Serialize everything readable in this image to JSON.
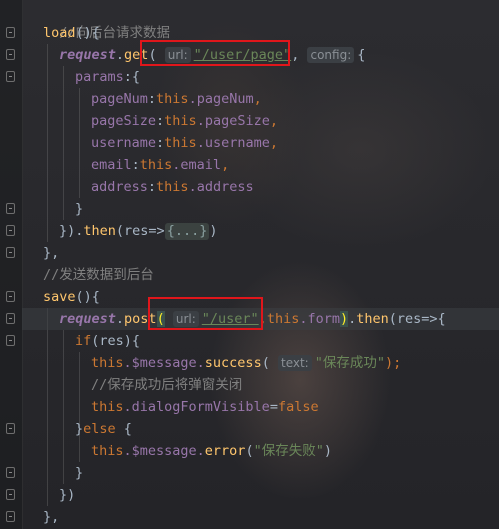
{
  "editor": {
    "lines": {
      "l1": "//向后台请求数据",
      "l2_name": "load",
      "l2_rest": "(){",
      "l3_obj": "request",
      "l3_dot": ".",
      "l3_method": "get",
      "l3_paren": "(",
      "l3_hint_url": "url:",
      "l3_url": "\"/user/page\"",
      "l3_comma": ",",
      "l3_hint_config": "config:",
      "l3_brace": "{",
      "l4_key": "params",
      "l4_rest": ":{",
      "l5_key": "pageNum",
      "l5_this": "this",
      "l5_prop": ".pageNum",
      "l5_end": ",",
      "l6_key": "pageSize",
      "l6_this": "this",
      "l6_prop": ".pageSize",
      "l6_end": ",",
      "l7_key": "username",
      "l7_this": "this",
      "l7_prop": ".username",
      "l7_end": ",",
      "l8_key": "email",
      "l8_this": "this",
      "l8_prop": ".email",
      "l8_end": ",",
      "l9_key": "address",
      "l9_this": "this",
      "l9_prop": ".address",
      "l10": "}",
      "l11_a": "}).",
      "l11_then": "then",
      "l11_b": "(res=>",
      "l11_folded": "{...}",
      "l11_c": ")",
      "l12": "},",
      "l13": "//发送数据到后台",
      "l14_name": "save",
      "l14_rest": "(){",
      "l15_obj": "request",
      "l15_dot": ".",
      "l15_method": "post",
      "l15_paren": "(",
      "l15_hint_url": "url:",
      "l15_url": "\"/user\"",
      "l15_comma": ",",
      "l15_this": "this",
      "l15_form": ".form",
      "l15_close": ")",
      "l15_dot2": ".",
      "l15_then": "then",
      "l15_rest": "(res=>{",
      "l16_if": "if",
      "l16_rest": "(res){",
      "l17_this": "this",
      "l17_msg": ".$message.",
      "l17_fn": "success",
      "l17_paren": "(",
      "l17_hint": "text:",
      "l17_str": "\"保存成功\"",
      "l17_end": ");",
      "l18": "//保存成功后将弹窗关闭",
      "l19_this": "this",
      "l19_prop": ".dialogFormVisible",
      "l19_eq": "=",
      "l19_val": "false",
      "l20_a": "}",
      "l20_else": "else",
      "l20_b": " {",
      "l21_this": "this",
      "l21_msg": ".$message.",
      "l21_fn": "error",
      "l21_paren": "(",
      "l21_str": "\"保存失败\"",
      "l21_end": ")",
      "l22": "}",
      "l23": "})",
      "l24": "},"
    }
  },
  "colors": {
    "comment": "#808080",
    "function": "#ffc66d",
    "keyword": "#cc7832",
    "string": "#6a8759",
    "property": "#9876aa",
    "highlight_box": "#e0161b"
  }
}
